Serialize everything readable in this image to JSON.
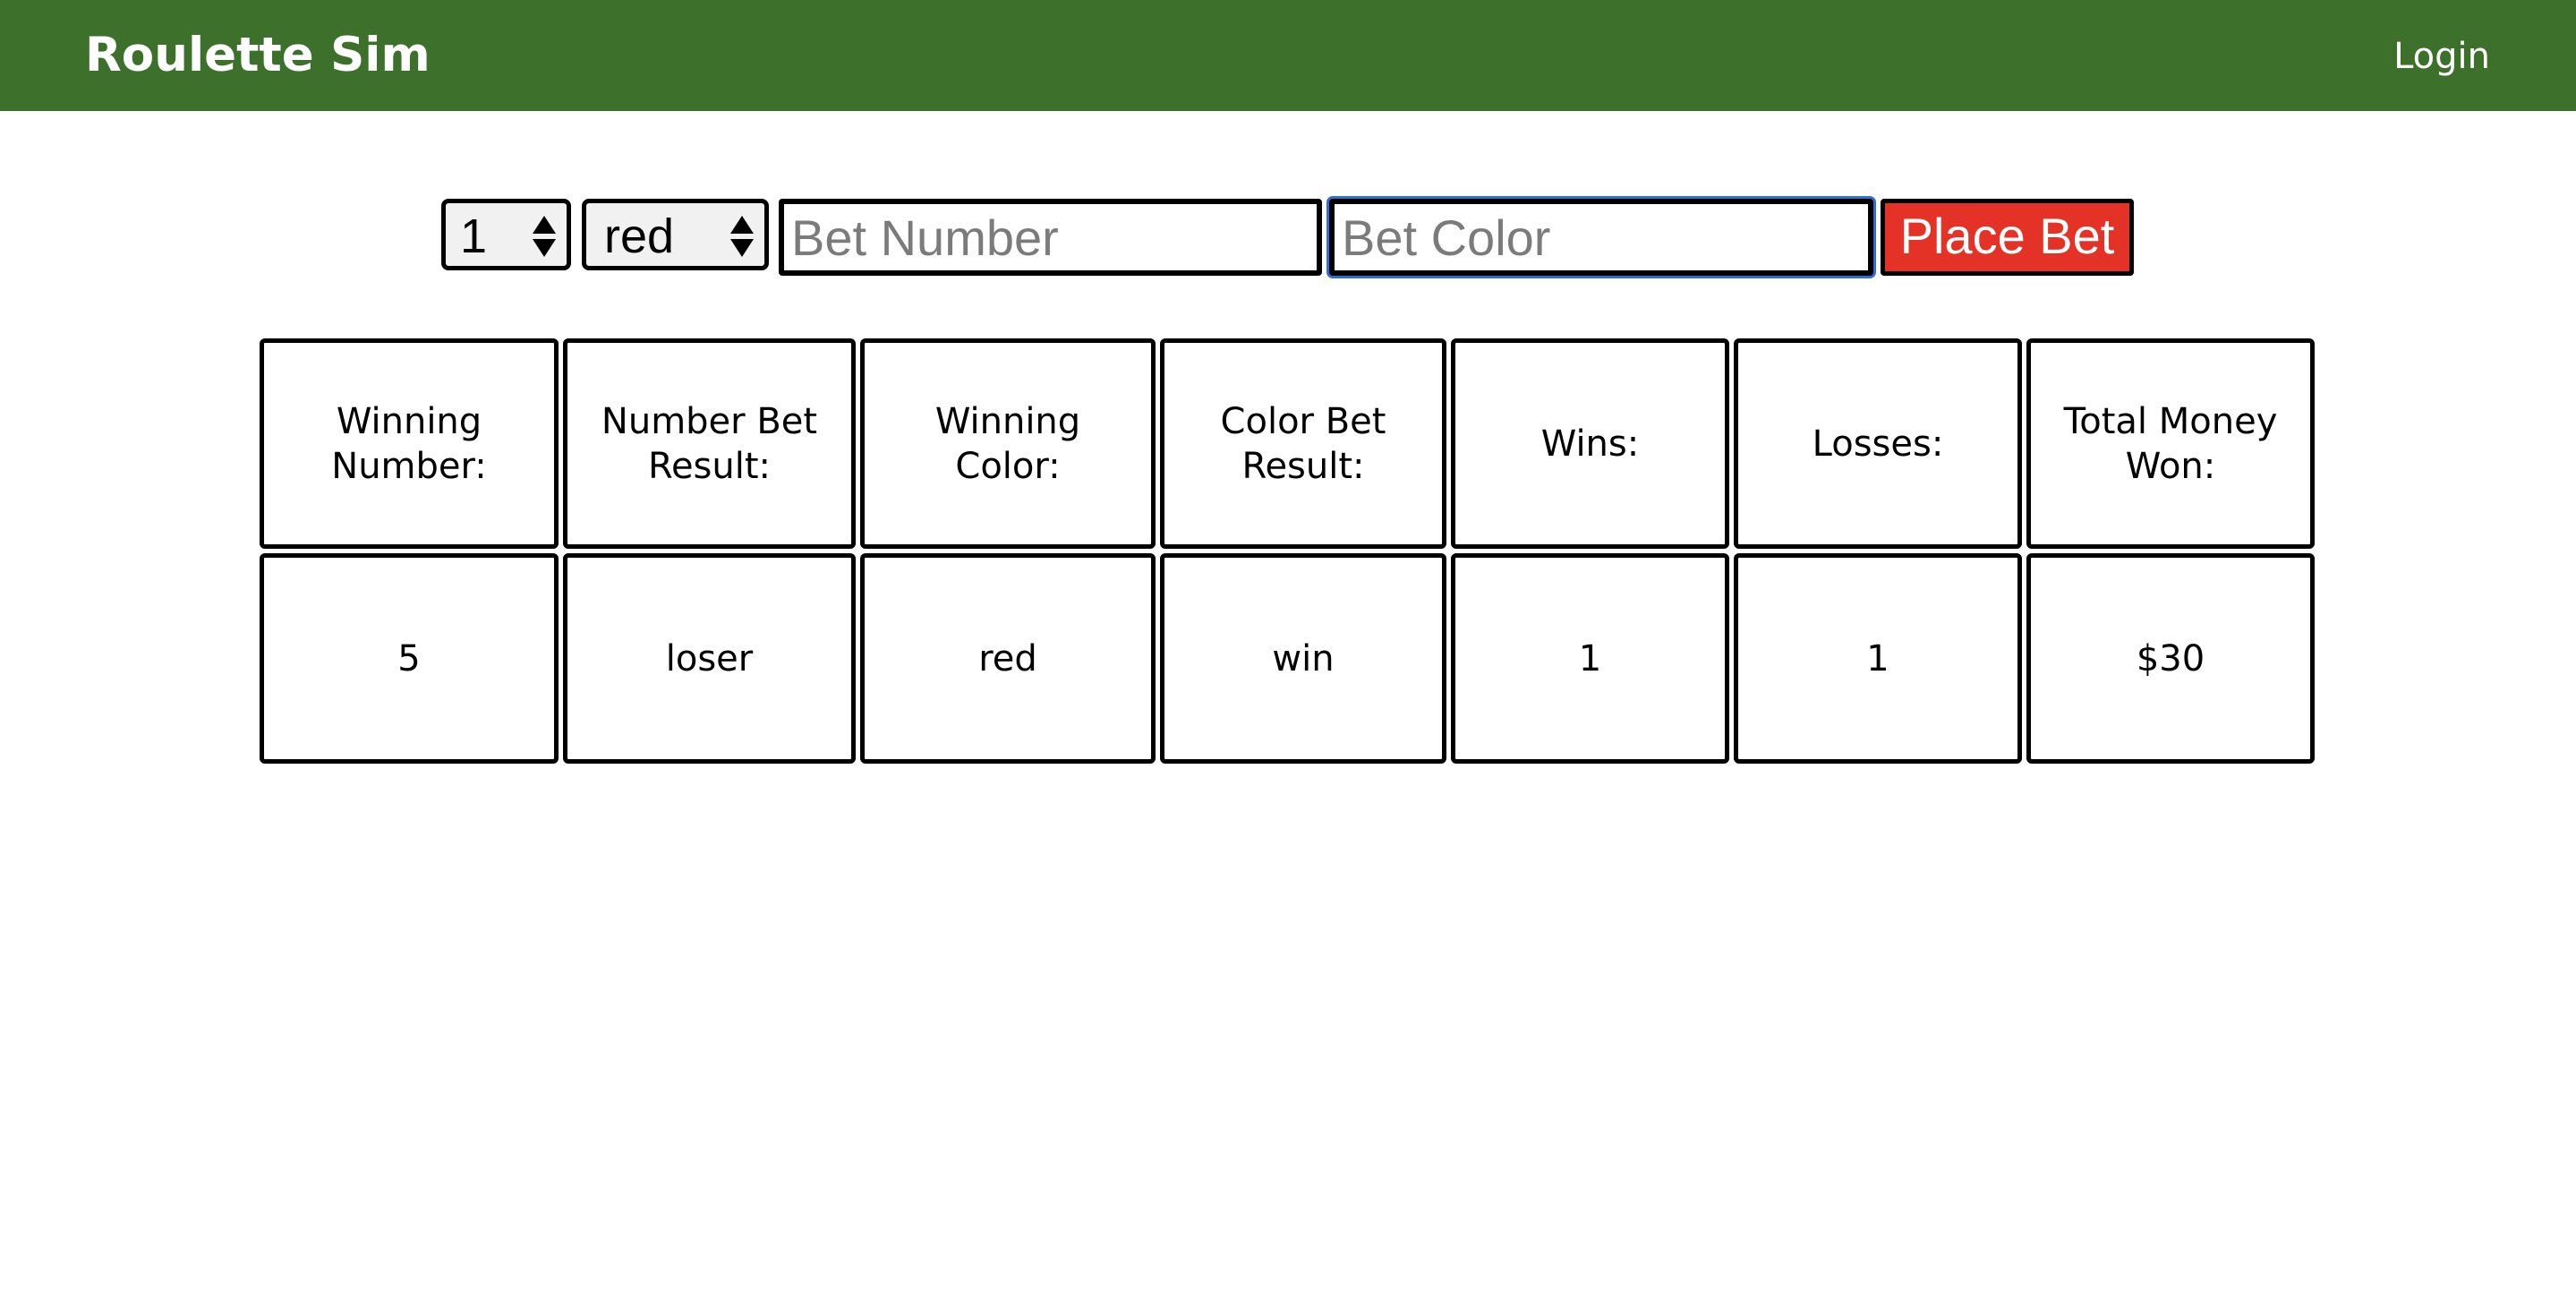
{
  "navbar": {
    "brand": "Roulette Sim",
    "login": "Login",
    "background_color": "#3d712b"
  },
  "bet_form": {
    "number_select_value": "1",
    "color_select_value": "red",
    "bet_number_placeholder": "Bet Number",
    "bet_color_placeholder": "Bet Color",
    "place_bet_label": "Place Bet",
    "place_bet_color": "#e53226"
  },
  "stats": {
    "headers": [
      "Winning Number:",
      "Number Bet Result:",
      "Winning Color:",
      "Color Bet Result:",
      "Wins:",
      "Losses:",
      "Total Money Won:"
    ],
    "values": [
      "5",
      "loser",
      "red",
      "win",
      "1",
      "1",
      "$30"
    ]
  }
}
